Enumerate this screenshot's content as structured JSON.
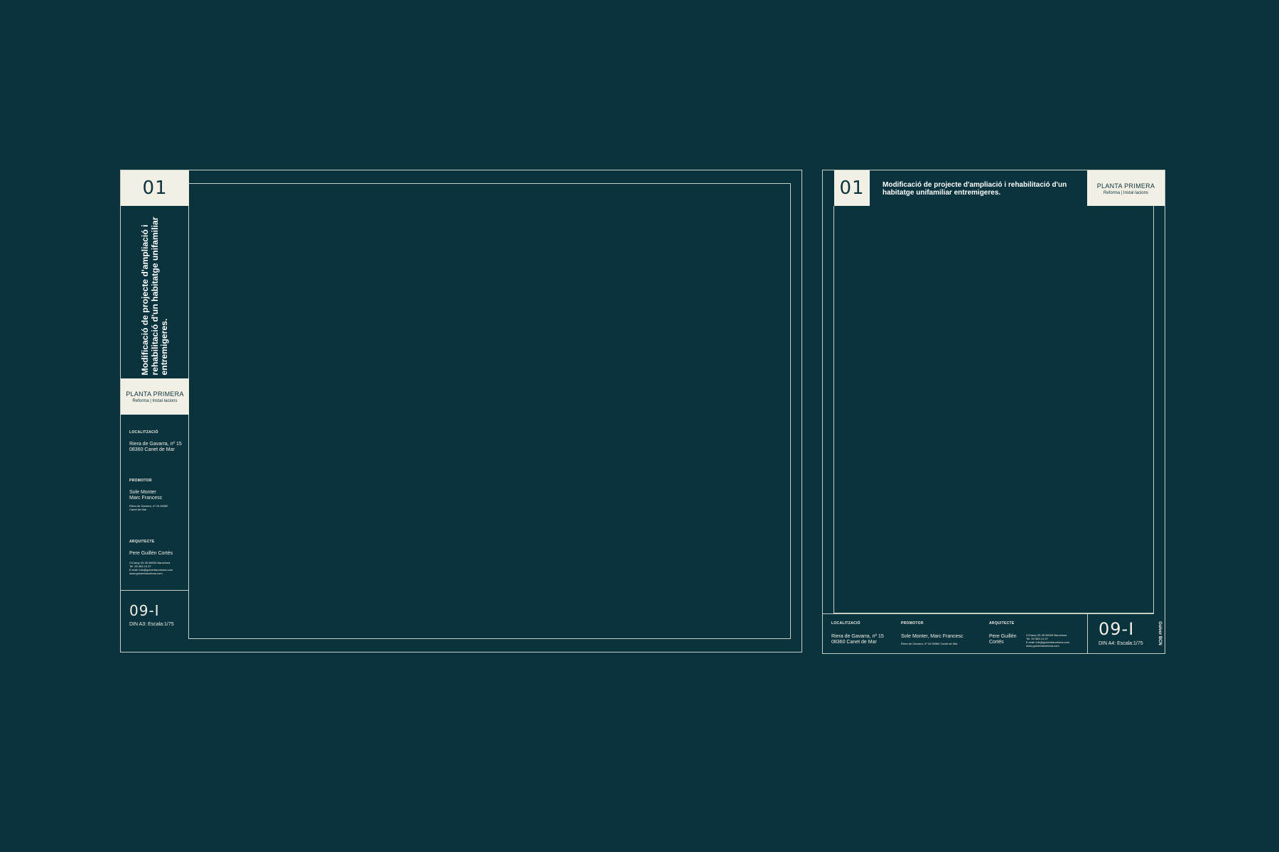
{
  "a3_sheet": {
    "number": "01",
    "title": "Modificació de projecte d'ampliació i rehabilitació d'un habitatge unifamiliar entremigeres.",
    "plan_name": "PLANTA PRIMERA",
    "plan_sub": "Reforma | Instal·lacions",
    "location_label": "LOCALITZACIÓ",
    "location_value": "Riera de Gavarra, nº 15\n08360 Canet de Mar",
    "promoter_label": "PROMOTOR",
    "promoter_value": "Sole Monter\nMarc Francesc",
    "promoter_address": "Riera de Gavarra, nº 15 08360\nCanet de Mar",
    "architect_label": "ARQUITECTE",
    "architect_value": "Pere Guillén Cortés",
    "architect_contact": "C/Camp 33-35 08030 Barcelona\nTel. 93 383 14 07\nE-mail: info@guiverbarcelona.com\nwww.guiverbarcelona.com",
    "scale_code": "09-I",
    "scale_text": "DIN A3: Escala:1/75"
  },
  "a4_sheet": {
    "number": "01",
    "title": "Modificació de projecte d'ampliació i rehabilitació d'un habitatge unifamiliar entremigeres.",
    "plan_name": "PLANTA PRIMERA",
    "plan_sub": "Reforma | Instal·lacions",
    "location_label": "LOCALITZACIÓ",
    "location_value": "Riera de Gavarra, nº 15\n08360 Canet de Mar",
    "promoter_label": "PROMOTOR",
    "promoter_value": "Sole Monter, Marc Francesc",
    "promoter_address": "Riera de Gavarra, nº 15 08360 Canet de Mar",
    "architect_label": "ARQUITECTE",
    "architect_value": "Pere Guillén\nCortés",
    "architect_contact": "C/Camp 33-35 08030 Barcelona\nTel. 93 383 14 07\nE-mail: info@guiverbarcelona.com\nwww.guiverbarcelona.com",
    "scale_code": "09-I",
    "scale_text": "DIN A4: Escala:1/75",
    "brand": "Guiver BCN"
  },
  "colors": {
    "background": "#0b333e",
    "cream": "#f2efe4",
    "line": "#c9cfc8"
  }
}
